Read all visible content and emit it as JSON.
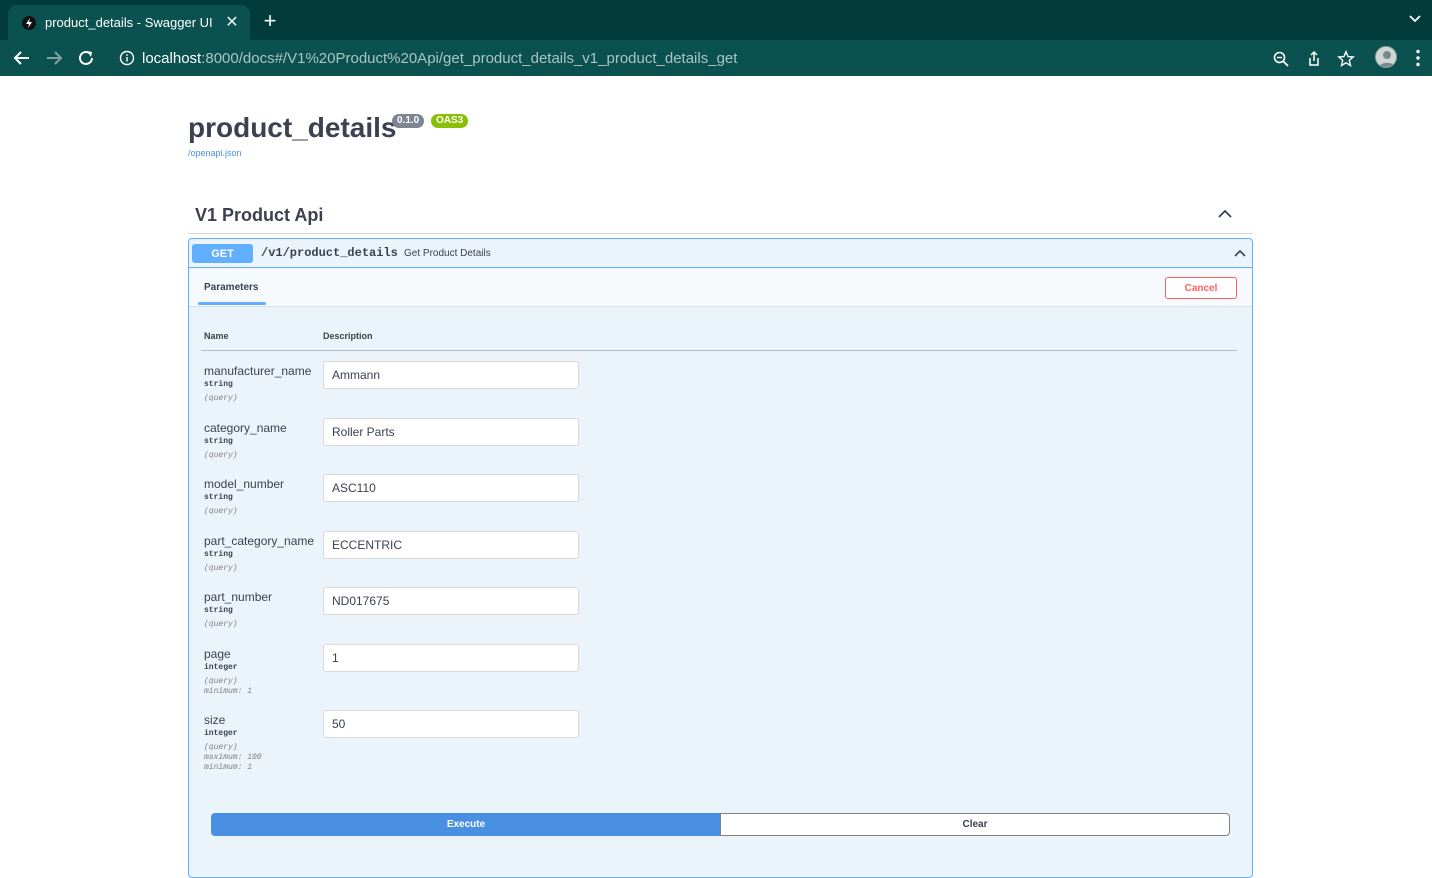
{
  "browser": {
    "tab_title": "product_details - Swagger UI",
    "tab_close": "✕",
    "new_tab": "+",
    "url_host": "localhost",
    "url_rest": ":8000/docs#/V1%20Product%20Api/get_product_details_v1_product_details_get",
    "icons": [
      "back-arrow-icon",
      "forward-arrow-icon",
      "reload-icon",
      "info-icon",
      "zoom-icon",
      "share-icon",
      "bookmark-star-icon",
      "profile-avatar",
      "more-menu-icon",
      "tab-list-chevron-icon"
    ]
  },
  "info": {
    "title": "product_details",
    "version": "0.1.0",
    "oas": "OAS3",
    "spec_link": "/openapi.json"
  },
  "section": {
    "title": "V1 Product Api"
  },
  "operation": {
    "method": "GET",
    "path": "/v1/product_details",
    "summary": "Get Product Details",
    "tab_label": "Parameters",
    "cancel_label": "Cancel",
    "col_name": "Name",
    "col_description": "Description",
    "execute_label": "Execute",
    "clear_label": "Clear",
    "params": [
      {
        "name": "manufacturer_name",
        "type": "string",
        "in": "(query)",
        "value": "Ammann",
        "extra": []
      },
      {
        "name": "category_name",
        "type": "string",
        "in": "(query)",
        "value": "Roller Parts",
        "extra": []
      },
      {
        "name": "model_number",
        "type": "string",
        "in": "(query)",
        "value": "ASC110",
        "extra": []
      },
      {
        "name": "part_category_name",
        "type": "string",
        "in": "(query)",
        "value": "ECCENTRIC",
        "extra": []
      },
      {
        "name": "part_number",
        "type": "string",
        "in": "(query)",
        "value": "ND017675",
        "extra": []
      },
      {
        "name": "page",
        "type": "integer",
        "in": "(query)",
        "value": "1",
        "extra": [
          "minimum: 1"
        ]
      },
      {
        "name": "size",
        "type": "integer",
        "in": "(query)",
        "value": "50",
        "extra": [
          "maximum: 100",
          "minimum: 1"
        ]
      }
    ]
  },
  "colors": {
    "browser_frame": "#023b3b",
    "browser_toolbar": "#0b5150",
    "get_blue": "#61affe",
    "opblock_bg": "#ebf3fb",
    "execute_blue": "#4990e2",
    "cancel_red": "#ff6060",
    "oas_green": "#89bf04",
    "version_grey": "#7d8492"
  }
}
